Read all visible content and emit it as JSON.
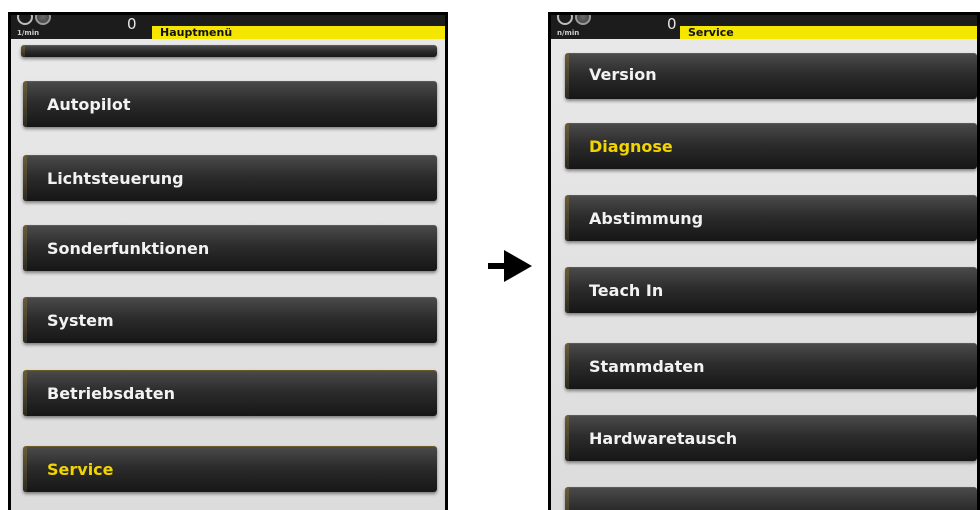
{
  "left_screen": {
    "unit": "1/min",
    "count": "0",
    "title": "Hauptmenü",
    "items": [
      {
        "label": "Autopilot",
        "active": false
      },
      {
        "label": "Lichtsteuerung",
        "active": false
      },
      {
        "label": "Sonderfunktionen",
        "active": false
      },
      {
        "label": "System",
        "active": false
      },
      {
        "label": "Betriebsdaten",
        "active": false
      },
      {
        "label": "Service",
        "active": true
      }
    ]
  },
  "right_screen": {
    "unit": "n/min",
    "count": "0",
    "title": "Service",
    "items": [
      {
        "label": "Version",
        "active": false
      },
      {
        "label": "Diagnose",
        "active": true
      },
      {
        "label": "Abstimmung",
        "active": false
      },
      {
        "label": "Teach In",
        "active": false
      },
      {
        "label": "Stammdaten",
        "active": false
      },
      {
        "label": "Hardwaretausch",
        "active": false
      }
    ]
  },
  "transition_icon": "right-arrow-icon",
  "colors": {
    "title_bar": "#f5e600",
    "active_label": "#f2d400",
    "button_dark": "#1c1c1c"
  }
}
